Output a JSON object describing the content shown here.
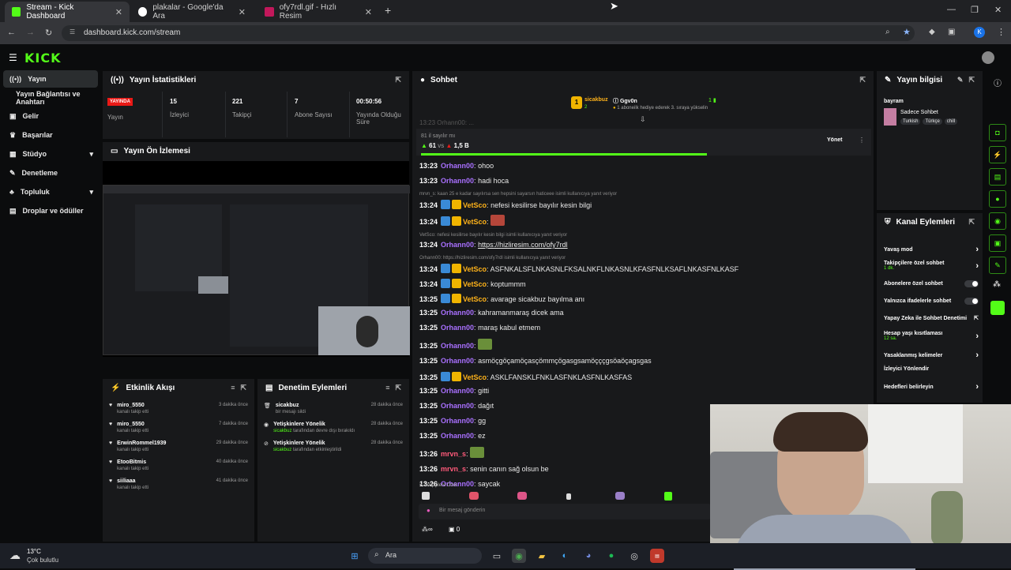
{
  "browser": {
    "tabs": [
      {
        "title": "Stream - Kick Dashboard"
      },
      {
        "title": "plakalar - Google'da Ara"
      },
      {
        "title": "ofy7rdl.gif - Hızlı Resim"
      }
    ],
    "url": "dashboard.kick.com/stream",
    "profile_initial": "K"
  },
  "kick": {
    "logo": "KICK"
  },
  "sidebar": {
    "items": [
      {
        "label": "Yayın"
      },
      {
        "label": "Yayın Bağlantısı ve Anahtarı"
      },
      {
        "label": "Gelir"
      },
      {
        "label": "Başarılar"
      },
      {
        "label": "Stüdyo"
      },
      {
        "label": "Denetleme"
      },
      {
        "label": "Topluluk"
      },
      {
        "label": "Droplar ve ödüller"
      }
    ]
  },
  "stats": {
    "title": "Yayın İstatistikleri",
    "live_badge": "YAYINDA",
    "live_label": "Yayın",
    "items": [
      {
        "value": "15",
        "label": "İzleyici"
      },
      {
        "value": "221",
        "label": "Takipçi"
      },
      {
        "value": "7",
        "label": "Abone Sayısı"
      },
      {
        "value": "00:50:56",
        "label": "Yayında Olduğu Süre"
      }
    ]
  },
  "preview": {
    "title": "Yayın Ön İzlemesi"
  },
  "activity": {
    "title": "Etkinlik Akışı",
    "items": [
      {
        "name": "miro_5550",
        "sub": "kanalı takip etti",
        "time": "3 dakika önce"
      },
      {
        "name": "miro_5550",
        "sub": "kanalı takip etti",
        "time": "7 dakika önce"
      },
      {
        "name": "ErwinRommel1939",
        "sub": "kanalı takip etti",
        "time": "29 dakika önce"
      },
      {
        "name": "EtooBitmis",
        "sub": "kanalı takip etti",
        "time": "40 dakika önce"
      },
      {
        "name": "siiliaaa",
        "sub": "kanalı takip etti",
        "time": "41 dakika önce"
      }
    ]
  },
  "mod": {
    "title": "Denetim Eylemleri",
    "items": [
      {
        "name": "sicakbuz",
        "sub": "bir mesajı sildi",
        "time": "28 dakika önce"
      },
      {
        "name": "Yetişkinlere Yönelik",
        "sub_user": "sicakbuz",
        "sub": "tarafından devre dışı bırakıldı",
        "time": "28 dakika önce"
      },
      {
        "name": "Yetişkinlere Yönelik",
        "sub_user": "sicakbuz",
        "sub": "tarafından etkinleştirildi",
        "time": "28 dakika önce"
      }
    ]
  },
  "chat": {
    "title": "Sohbet",
    "gifter": {
      "name": "sicakbuz",
      "count": "2",
      "target": "Ggv0n",
      "text": "1 aboneilk hediye ederek 3. sıraya yükselin",
      "rank": "1"
    },
    "poll": {
      "question": "81 il sayılır mı",
      "left": "61",
      "vs": "vs",
      "right": "1,5 B",
      "manage": "Yönet"
    },
    "messages": [
      {
        "time": "13:23",
        "user": "Orhann00",
        "color": "#a970ff",
        "text": "ohoo"
      },
      {
        "time": "13:23",
        "user": "Orhann00",
        "color": "#a970ff",
        "text": "hadi hoca"
      },
      {
        "reply": "mrvn_s: kaan 25 e kadar sayılırsa sen hepsini sayarsın haticeee isimli kullanıcıya yanıt veriyor"
      },
      {
        "time": "13:24",
        "user": "VetSco",
        "color": "#ffb31a",
        "text": "nefesi kesilirse bayılır kesin bilgi",
        "badges": true
      },
      {
        "time": "13:24",
        "user": "VetSco",
        "color": "#ffb31a",
        "text": "",
        "badges": true
      },
      {
        "reply": "VetSco: nefesi kesilirse bayılır kesin bilgi isimli kullanıcıya yanıt veriyor"
      },
      {
        "time": "13:24",
        "user": "Orhann00",
        "color": "#a970ff",
        "text": "https://hizliresim.com/ofy7rdl"
      },
      {
        "reply": "Orhann00: https://hizliresim.com/ofy7rdl isimli kullanıcıya yanıt veriyor"
      },
      {
        "time": "13:24",
        "user": "VetSco",
        "color": "#ffb31a",
        "text": "ASFNKALSFLNKASNLFKSALNKFLNKASNLKFASFNLKSAFLNKASFNLKASF",
        "badges": true
      },
      {
        "time": "13:24",
        "user": "VetSco",
        "color": "#ffb31a",
        "text": "koptummm",
        "badges": true
      },
      {
        "time": "13:25",
        "user": "VetSco",
        "color": "#ffb31a",
        "text": "avarage sicakbuz bayılma anı",
        "badges": true
      },
      {
        "time": "13:25",
        "user": "Orhann00",
        "color": "#a970ff",
        "text": "kahramanmaraş dicek ama"
      },
      {
        "time": "13:25",
        "user": "Orhann00",
        "color": "#a970ff",
        "text": "maraş kabul etmem"
      },
      {
        "time": "13:25",
        "user": "Orhann00",
        "color": "#a970ff",
        "text": ""
      },
      {
        "time": "13:25",
        "user": "Orhann00",
        "color": "#a970ff",
        "text": "asmöçgöçamöçasçömmçögasgsamöçççgsöaöçagsgas"
      },
      {
        "time": "13:25",
        "user": "VetSco",
        "color": "#ffb31a",
        "text": "ASKLFANSKLFNKLASFNKLASFNLKASFAS",
        "badges": true
      },
      {
        "time": "13:25",
        "user": "Orhann00",
        "color": "#a970ff",
        "text": "gitti"
      },
      {
        "time": "13:25",
        "user": "Orhann00",
        "color": "#a970ff",
        "text": "dağıt"
      },
      {
        "time": "13:25",
        "user": "Orhann00",
        "color": "#a970ff",
        "text": "gg"
      },
      {
        "time": "13:25",
        "user": "Orhann00",
        "color": "#a970ff",
        "text": "ez"
      },
      {
        "time": "13:26",
        "user": "mrvn_s",
        "color": "#ff5a7a",
        "text": ""
      },
      {
        "time": "13:26",
        "user": "mrvn_s",
        "color": "#ff5a7a",
        "text": "senin canın sağ olsun be"
      },
      {
        "time": "13:26",
        "user": "Orhann00",
        "color": "#a970ff",
        "text": "saycak"
      }
    ],
    "followers_only": "Takipçilere Özel",
    "input_placeholder": "Bir mesaj gönderin",
    "footer_count": "0"
  },
  "streaminfo": {
    "title": "Yayın bilgisi",
    "stream_title": "bayram",
    "category": "Sadece Sohbet",
    "tags": [
      "Turkish",
      "Türkçe",
      "chill"
    ]
  },
  "actions": {
    "title": "Kanal Eylemleri",
    "items": [
      {
        "label": "Yavaş mod",
        "end": "chev"
      },
      {
        "label": "Takipçilere özel sohbet",
        "sub": "1 dk.",
        "end": "chev"
      },
      {
        "label": "Abonelere özel sohbet",
        "end": "toggle"
      },
      {
        "label": "Yalnızca ifadelerle sohbet",
        "end": "toggle"
      },
      {
        "label": "Yapay Zeka ile Sohbet Denetimi",
        "end": "ext"
      },
      {
        "label": "Hesap yaşı kısıtlaması",
        "sub": "12 sa.",
        "end": "chev"
      },
      {
        "label": "Yasaklanmış kelimeler",
        "end": "chev"
      },
      {
        "label": "İzleyici Yönlendir",
        "end": ""
      },
      {
        "label": "Hedefleri belirleyin",
        "end": "chev"
      }
    ]
  },
  "taskbar": {
    "weather_temp": "13°C",
    "weather_text": "Çok bulutlu",
    "search": "Ara"
  },
  "colors": {
    "accent": "#53fc18",
    "live": "#e91916",
    "panel": "#18191b",
    "bg": "#0b0c0d"
  }
}
